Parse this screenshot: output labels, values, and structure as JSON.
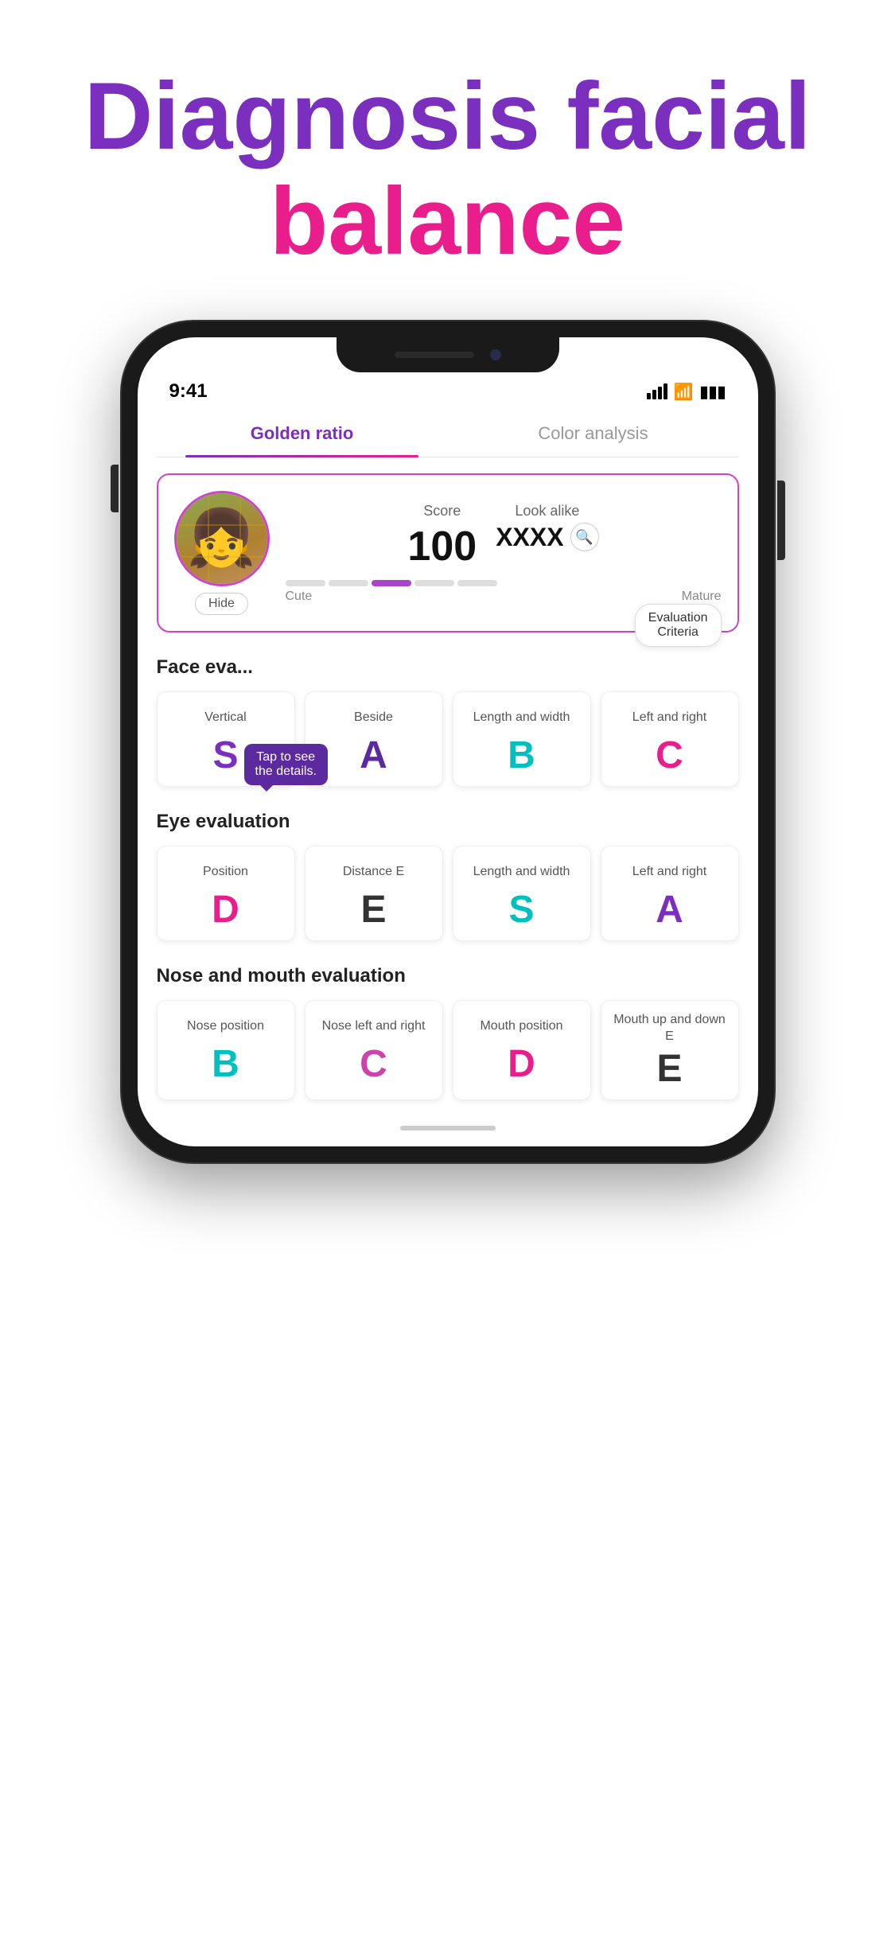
{
  "header": {
    "line1_purple": "Diagnosis facial",
    "line2_pink": "balance"
  },
  "phone": {
    "status_time": "9:41",
    "tabs": [
      {
        "id": "golden",
        "label": "Golden ratio",
        "active": true
      },
      {
        "id": "color",
        "label": "Color analysis",
        "active": false
      }
    ],
    "score_card": {
      "hide_label": "Hide",
      "score_label": "Score",
      "score_value": "100",
      "look_alike_label": "Look alike",
      "look_alike_value": "XXXX",
      "gauge_cute": "Cute",
      "gauge_mature": "Mature"
    },
    "eval_criteria_label": "Evaluation\nCriteria",
    "tooltip": "Tap to see\nthe details.",
    "face_eval": {
      "title": "Face eva...",
      "items": [
        {
          "label": "Vertical",
          "grade": "S",
          "color": "grade-purple"
        },
        {
          "label": "Beside",
          "grade": "A",
          "color": "grade-dark-purple"
        },
        {
          "label": "Length and width",
          "grade": "B",
          "color": "grade-cyan"
        },
        {
          "label": "Left and right",
          "grade": "C",
          "color": "grade-pink"
        }
      ]
    },
    "eye_eval": {
      "title": "Eye evaluation",
      "items": [
        {
          "label": "Position",
          "grade": "D",
          "color": "grade-pink"
        },
        {
          "label": "Distance E",
          "grade": "E",
          "color": "grade-dark"
        },
        {
          "label": "Length and width",
          "grade": "S",
          "color": "grade-cyan"
        },
        {
          "label": "Left and right",
          "grade": "A",
          "color": "grade-purple"
        }
      ]
    },
    "nose_mouth_eval": {
      "title": "Nose and mouth evaluation",
      "items": [
        {
          "label": "Nose position",
          "grade": "B",
          "color": "grade-cyan"
        },
        {
          "label": "Nose left and right",
          "grade": "C",
          "color": "grade-magenta"
        },
        {
          "label": "Mouth position",
          "grade": "D",
          "color": "grade-pink"
        },
        {
          "label": "Mouth up and down E",
          "grade": "E",
          "color": "grade-dark"
        }
      ]
    }
  }
}
